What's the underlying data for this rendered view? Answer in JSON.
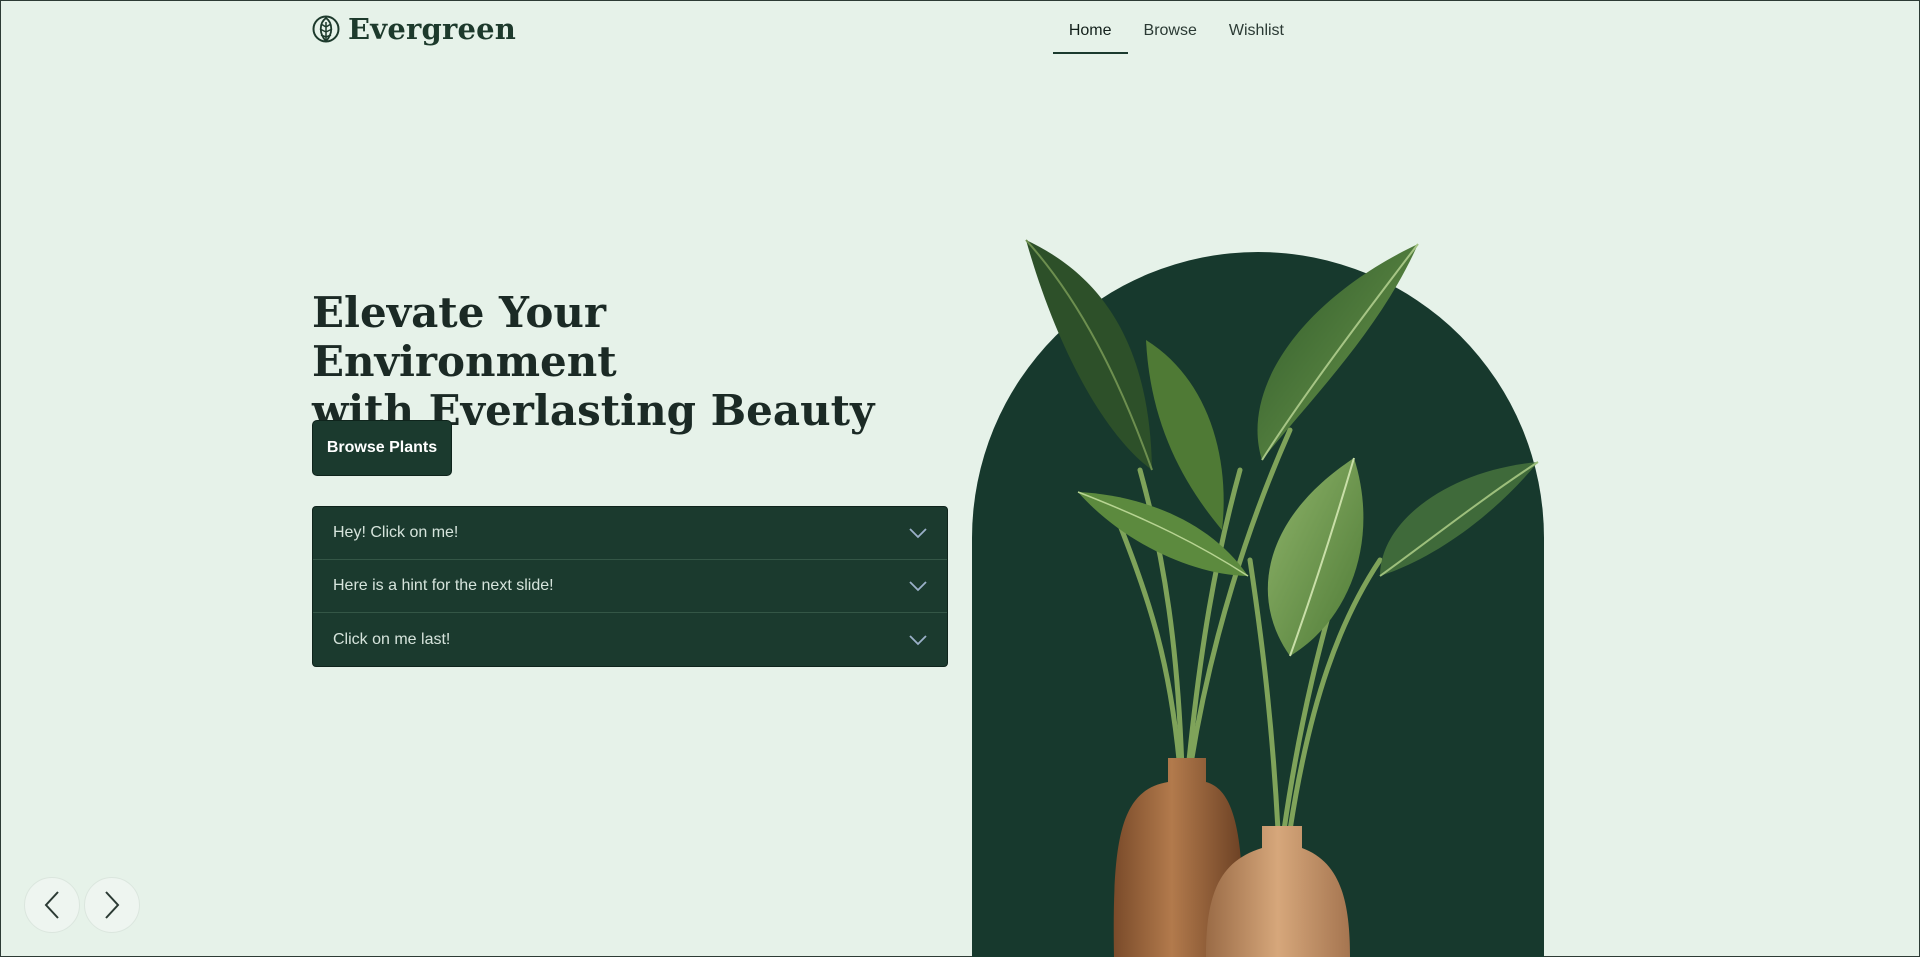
{
  "brand": {
    "name": "Evergreen",
    "logo_icon": "leaf-icon",
    "primary_color": "#1b3a2e",
    "background_color": "#e6f2e9"
  },
  "nav": {
    "items": [
      {
        "label": "Home",
        "active": true
      },
      {
        "label": "Browse",
        "active": false
      },
      {
        "label": "Wishlist",
        "active": false
      }
    ]
  },
  "hero": {
    "headline_line1": "Elevate Your Environment",
    "headline_line2": "with Everlasting Beauty",
    "cta_label": "Browse Plants",
    "image_description_icon": "plant-in-vases-image"
  },
  "accordion": {
    "items": [
      {
        "label": "Hey! Click on me!",
        "icon": "chevron-down-icon",
        "expanded": false
      },
      {
        "label": "Here is a hint for the next slide!",
        "icon": "chevron-down-icon",
        "expanded": false
      },
      {
        "label": "Click on me last!",
        "icon": "chevron-down-icon",
        "expanded": false
      }
    ]
  },
  "carousel": {
    "prev_icon": "chevron-left-icon",
    "next_icon": "chevron-right-icon"
  }
}
